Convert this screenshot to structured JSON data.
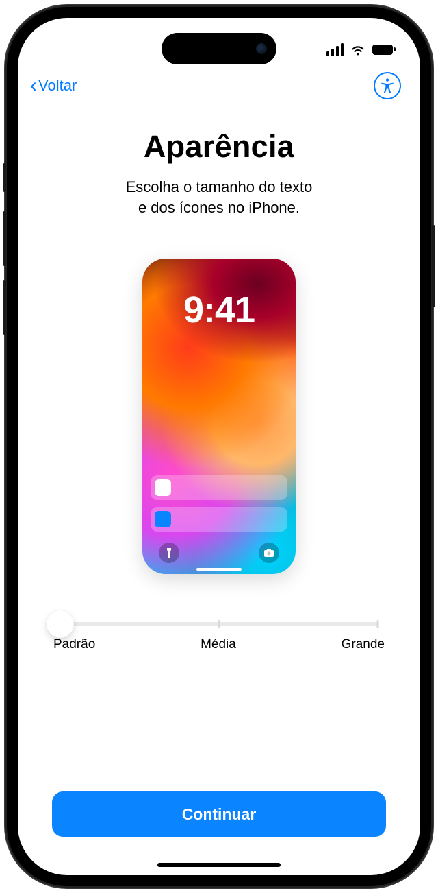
{
  "nav": {
    "back_label": "Voltar"
  },
  "header": {
    "title": "Aparência",
    "subtitle_line1": "Escolha o tamanho do texto",
    "subtitle_line2": "e dos ícones no iPhone."
  },
  "preview": {
    "time": "9:41"
  },
  "slider": {
    "labels": {
      "default": "Padrão",
      "medium": "Média",
      "large": "Grande"
    },
    "value": "default"
  },
  "actions": {
    "continue": "Continuar"
  },
  "colors": {
    "accent": "#007AFF",
    "button": "#0a84ff"
  }
}
